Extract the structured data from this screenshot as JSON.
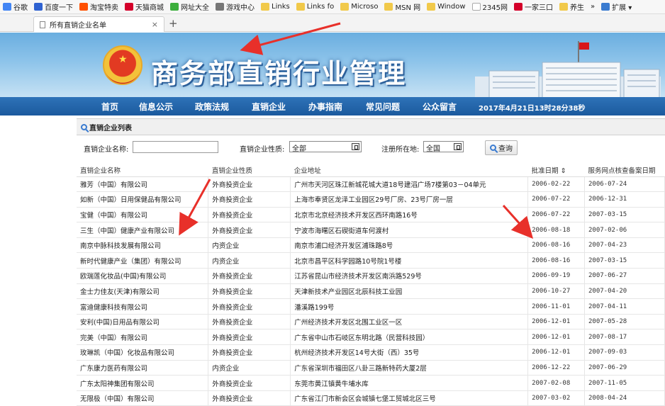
{
  "browser": {
    "bookmarks": [
      {
        "label": "谷歌",
        "color": "#4285f4"
      },
      {
        "label": "百度一下",
        "color": "#2f62d1"
      },
      {
        "label": "淘宝特卖",
        "color": "#ff5000"
      },
      {
        "label": "天猫商城",
        "color": "#d4002a"
      },
      {
        "label": "网址大全",
        "color": "#3cae3c"
      },
      {
        "label": "游戏中心",
        "color": "#777777"
      },
      {
        "label": "Links",
        "color": "#f1c94a"
      },
      {
        "label": "Links fo",
        "color": "#f1c94a"
      },
      {
        "label": "Microso",
        "color": "#f1c94a"
      },
      {
        "label": "MSN 网",
        "color": "#f1c94a"
      },
      {
        "label": "Window",
        "color": "#f1c94a"
      },
      {
        "label": "2345网",
        "color": "#ffffff"
      },
      {
        "label": "一家三口",
        "color": "#d4002a"
      },
      {
        "label": "养生",
        "color": "#f1c94a"
      },
      {
        "label": "»",
        "color": ""
      },
      {
        "label": "扩展 ▾",
        "color": "#3a7bd0"
      }
    ],
    "tab_title": "所有直销企业名单",
    "tab_close": "×",
    "new_tab": "+"
  },
  "site": {
    "title": "商务部直销行业管理",
    "nav": [
      "首页",
      "信息公示",
      "政策法规",
      "直销企业",
      "办事指南",
      "常见问题",
      "公众留言"
    ],
    "datetime": "2017年4月21日13时28分38秒"
  },
  "panel": {
    "heading": "直销企业列表",
    "name_label": "直销企业名称:",
    "nature_label": "直销企业性质:",
    "nature_value": "全部",
    "location_label": "注册所在地:",
    "location_value": "全国",
    "search_button": "查询"
  },
  "table": {
    "headers": [
      "直销企业名称",
      "直销企业性质",
      "企业地址",
      "批准日期 ⇕",
      "服务网点核查备案日期"
    ],
    "rows": [
      [
        "雅芳（中国）有限公司",
        "外商投资企业",
        "广州市天河区珠江新城花城大道18号建滔广场7楼第03－04单元",
        "2006-02-22",
        "2006-07-24"
      ],
      [
        "如新（中国）日用保健品有限公司",
        "外商投资企业",
        "上海市奉贤区龙泽工业园区29号厂房、23号厂房一层",
        "2006-07-22",
        "2006-12-31"
      ],
      [
        "宝健（中国）有限公司",
        "外商投资企业",
        "北京市北京经济技术开发区西环南路16号",
        "2006-07-22",
        "2007-03-15"
      ],
      [
        "三生（中国）健康产业有限公司",
        "外商投资企业",
        "宁波市海曙区石碶街道车何渡村",
        "2006-08-18",
        "2007-02-06"
      ],
      [
        "南京中脉科技发展有限公司",
        "内资企业",
        "南京市浦口经济开发区浦珠路8号",
        "2006-08-16",
        "2007-04-23"
      ],
      [
        "新时代健康产业（集团）有限公司",
        "内资企业",
        "北京市昌平区科学园路10号院1号楼",
        "2006-08-16",
        "2007-03-15"
      ],
      [
        "欧瑞莲化妆品(中国)有限公司",
        "外商投资企业",
        "江苏省昆山市经济技术开发区南浜路529号",
        "2006-09-19",
        "2007-06-27"
      ],
      [
        "金士力佳友(天津)有限公司",
        "外商投资企业",
        "天津新技术产业园区北辰科技工业园",
        "2006-10-27",
        "2007-04-20"
      ],
      [
        "富迪健康科技有限公司",
        "外商投资企业",
        "潘溪路199号",
        "2006-11-01",
        "2007-04-11"
      ],
      [
        "安利(中国)日用品有限公司",
        "外商投资企业",
        "广州经济技术开发区北围工业区一区",
        "2006-12-01",
        "2007-05-28"
      ],
      [
        "完美（中国）有限公司",
        "外商投资企业",
        "广东省中山市石岐区东明北路（民营科技园）",
        "2006-12-01",
        "2007-08-17"
      ],
      [
        "玫琳凯（中国）化妆品有限公司",
        "外商投资企业",
        "杭州经济技术开发区14号大街（西）35号",
        "2006-12-01",
        "2007-09-03"
      ],
      [
        "广东康力医药有限公司",
        "内资企业",
        "广东省深圳市福田区八卦三路新特药大厦2层",
        "2006-12-22",
        "2007-06-29"
      ],
      [
        "广东太阳神集团有限公司",
        "外商投资企业",
        "东莞市黄江镇黄牛埔水库",
        "2007-02-08",
        "2007-11-05"
      ],
      [
        "无限极（中国）有限公司",
        "外商投资企业",
        "广东省江门市新会区会城镇七堡工贸城北区三号",
        "2007-03-02",
        "2008-04-24"
      ]
    ]
  },
  "annotations": {
    "arrow_color": "#e8302a"
  }
}
